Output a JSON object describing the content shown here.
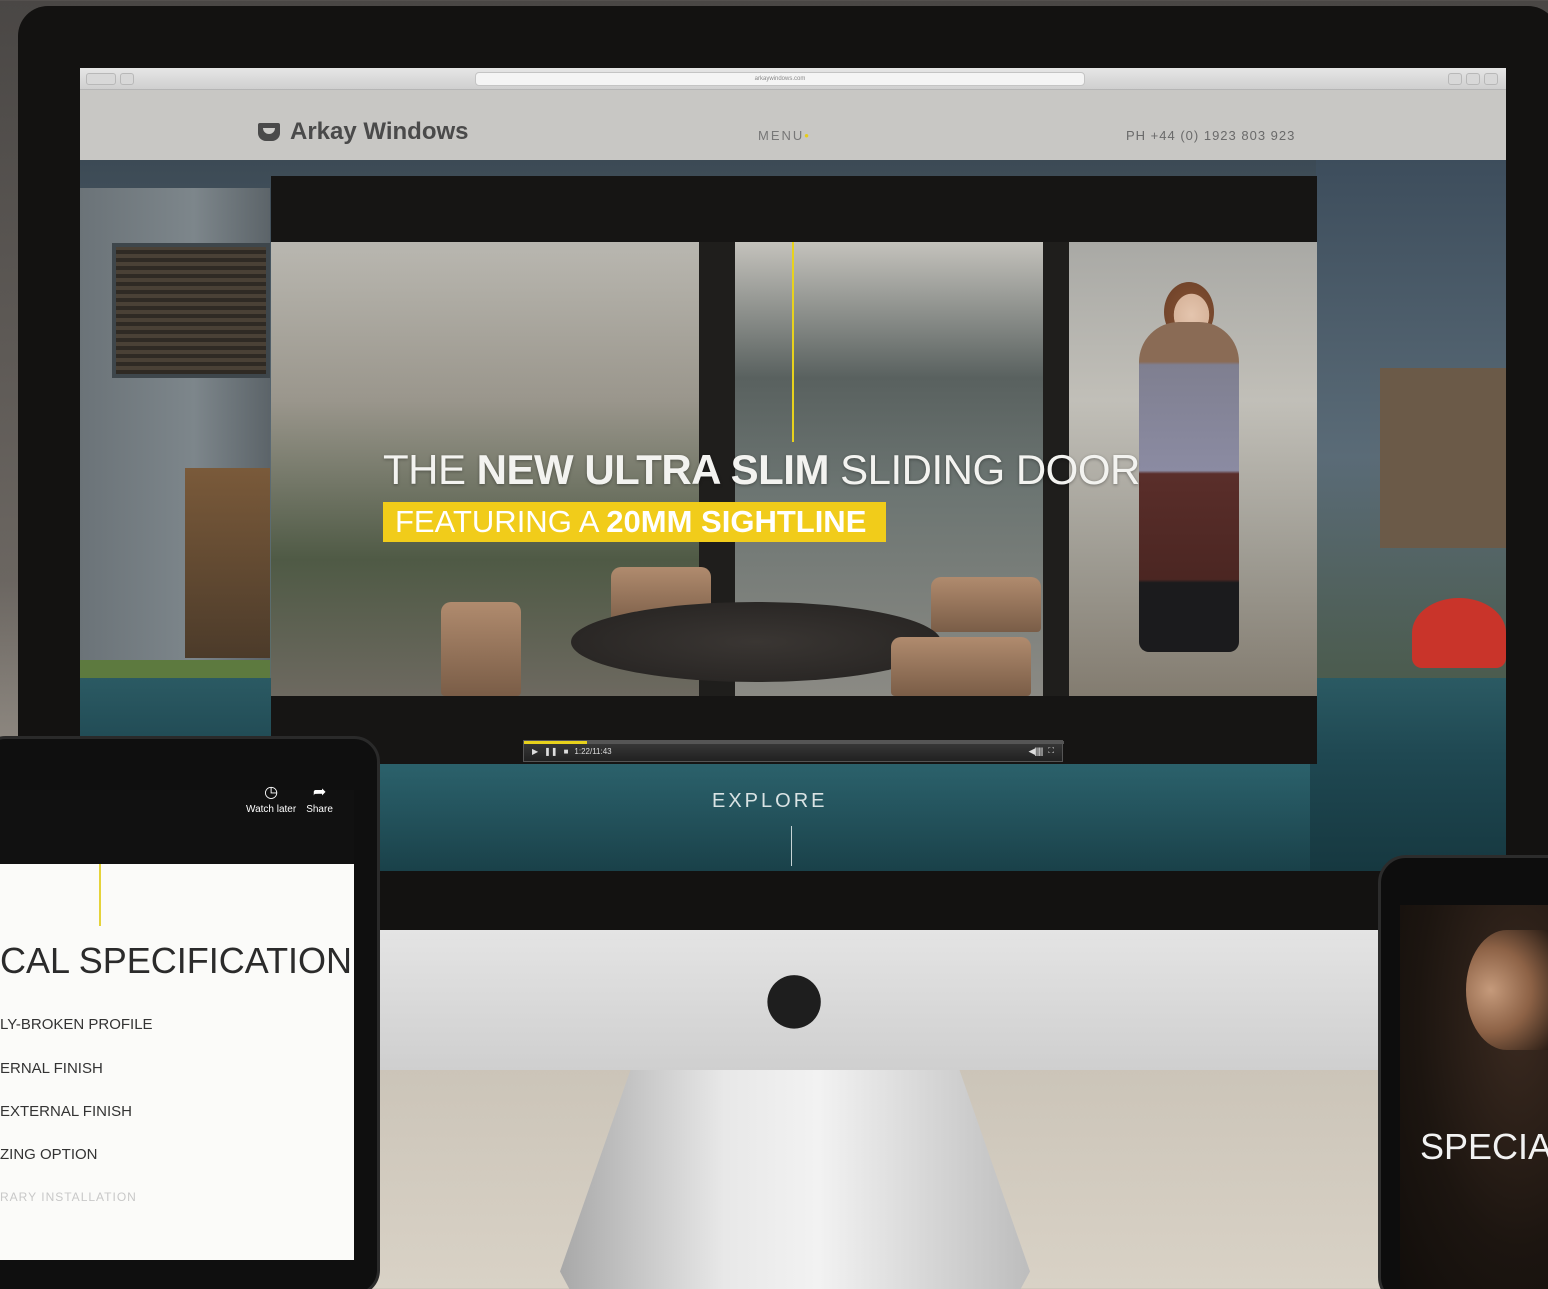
{
  "browser": {
    "address": "arkaywindows.com"
  },
  "site": {
    "logo_text": "Arkay Windows",
    "menu_label": "MENU",
    "menu_dot": "•",
    "phone": "PH +44 (0) 1923 803 923"
  },
  "hero": {
    "headline_prefix": "THE ",
    "headline_bold": "NEW ULTRA SLIM",
    "headline_suffix": " SLIDING DOOR",
    "subheadline_prefix": "FEATURING A ",
    "subheadline_bold": "20MM SIGHTLINE",
    "explore_label": "EXPLORE"
  },
  "video": {
    "play_icon": "play-icon",
    "pause_icon": "pause-icon",
    "stop_icon": "stop-icon",
    "time": "1:22/11:43",
    "progress": 0.117,
    "volume_icon": "volume-icon",
    "volume_bars": "◀||||||",
    "fullscreen_icon": "fullscreen-icon",
    "fullscreen_glyph": "⛶"
  },
  "tablet_left": {
    "actions": [
      {
        "label": "Watch later",
        "icon": "clock-icon",
        "glyph": "◷"
      },
      {
        "label": "Share",
        "icon": "share-icon",
        "glyph": "➦"
      }
    ],
    "spec_title": "CAL SPECIFICATION",
    "spec_items": [
      "LY-BROKEN PROFILE",
      "ERNAL FINISH",
      "EXTERNAL FINISH",
      "ZING OPTION",
      "RARY INSTALLATION"
    ]
  },
  "tablet_right": {
    "text": "SPECIA"
  },
  "colors": {
    "accent_yellow": "#f1cc1a",
    "header_bg": "#cecdca",
    "device_black": "#131211"
  }
}
